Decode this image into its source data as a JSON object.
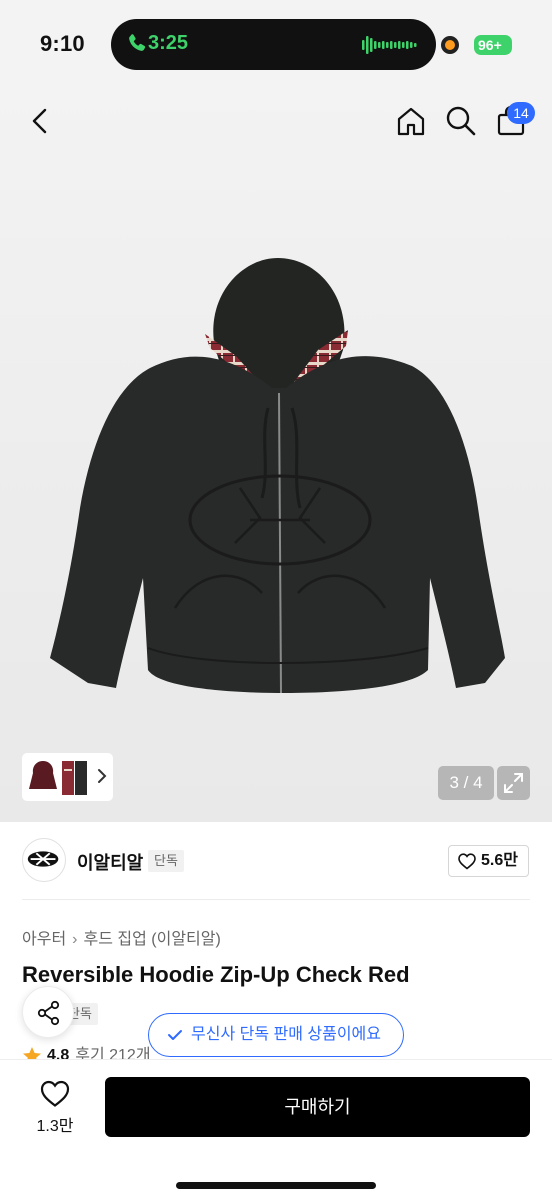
{
  "status_bar": {
    "time": "9:10",
    "call_time": "3:25",
    "battery": "96+"
  },
  "header": {
    "cart_count": "14",
    "icons": [
      "back-icon",
      "home-icon",
      "search-icon",
      "bag-icon"
    ]
  },
  "gallery": {
    "page_counter": "3 / 4"
  },
  "brand": {
    "name": "이알티알",
    "exclusive_label": "단독",
    "like_count": "5.6만"
  },
  "breadcrumb": {
    "category": "아우터",
    "subcategory": "후드 집업 (이알티알)"
  },
  "product": {
    "title": "Reversible Hoodie Zip-Up Check Red",
    "exclusive_label": "단독",
    "rating": "4.8",
    "reviews": "후기 212개"
  },
  "toast": {
    "text": "무신사 단독 판매 상품이에요"
  },
  "bottom_bar": {
    "wish_count": "1.3만",
    "buy_label": "구매하기"
  },
  "colors": {
    "accent_blue": "#2f6bff",
    "call_green": "#3ed26b",
    "buy_button": "#000000"
  }
}
